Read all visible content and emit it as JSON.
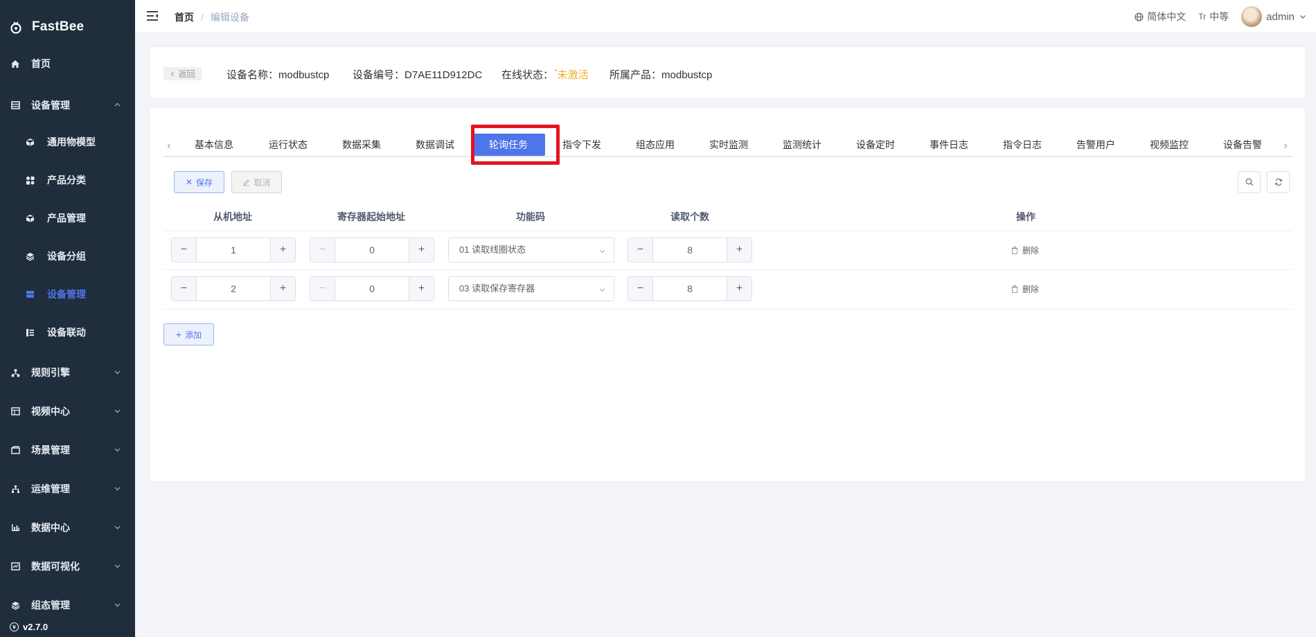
{
  "app": {
    "name": "FastBee",
    "version": "v2.7.0"
  },
  "sidebar": {
    "items": [
      {
        "label": "首页",
        "icon": "home-icon"
      },
      {
        "label": "设备管理",
        "icon": "device-icon"
      },
      {
        "label": "通用物模型",
        "icon": "cube-icon"
      },
      {
        "label": "产品分类",
        "icon": "category-icon"
      },
      {
        "label": "产品管理",
        "icon": "product-icon"
      },
      {
        "label": "设备分组",
        "icon": "layers-icon"
      },
      {
        "label": "设备管理",
        "icon": "device-list-icon"
      },
      {
        "label": "设备联动",
        "icon": "linkage-icon"
      },
      {
        "label": "规则引擎",
        "icon": "rule-icon"
      },
      {
        "label": "视频中心",
        "icon": "video-icon"
      },
      {
        "label": "场景管理",
        "icon": "scene-icon"
      },
      {
        "label": "运维管理",
        "icon": "ops-icon"
      },
      {
        "label": "数据中心",
        "icon": "chart-icon"
      },
      {
        "label": "数据可视化",
        "icon": "visual-icon"
      },
      {
        "label": "组态管理",
        "icon": "config-icon"
      }
    ]
  },
  "navbar": {
    "breadcrumb_home": "首页",
    "breadcrumb_sep": "/",
    "breadcrumb_current": "编辑设备",
    "language": "简体中文",
    "size_icon": "Tr",
    "size": "中等",
    "user": "admin"
  },
  "device": {
    "back": "返回",
    "name_label": "设备名称：",
    "name": "modbustcp",
    "serial_label": "设备编号：",
    "serial": "D7AE11D912DC",
    "status_label": "在线状态：",
    "status": "未激活",
    "product_label": "所属产品：",
    "product": "modbustcp"
  },
  "tabs": {
    "items": [
      "基本信息",
      "运行状态",
      "数据采集",
      "数据调试",
      "轮询任务",
      "指令下发",
      "组态应用",
      "实时监测",
      "监测统计",
      "设备定时",
      "事件日志",
      "指令日志",
      "告警用户",
      "视频监控",
      "设备告警"
    ],
    "active": "轮询任务"
  },
  "toolbar": {
    "save": "保存",
    "cancel": "取消",
    "add": "添加"
  },
  "table": {
    "headers": [
      "从机地址",
      "寄存器起始地址",
      "功能码",
      "读取个数",
      "操作"
    ],
    "rows": [
      {
        "slave": "1",
        "start": "0",
        "func": "01 读取线圈状态",
        "count": "8",
        "action": "删除"
      },
      {
        "slave": "2",
        "start": "0",
        "func": "03 读取保存寄存器",
        "count": "8",
        "action": "删除"
      }
    ]
  },
  "colors": {
    "sidebar_bg": "#1f2d3d",
    "accent": "#4e75ea",
    "highlight": "#e3141f",
    "warning": "#f0ae2d"
  }
}
